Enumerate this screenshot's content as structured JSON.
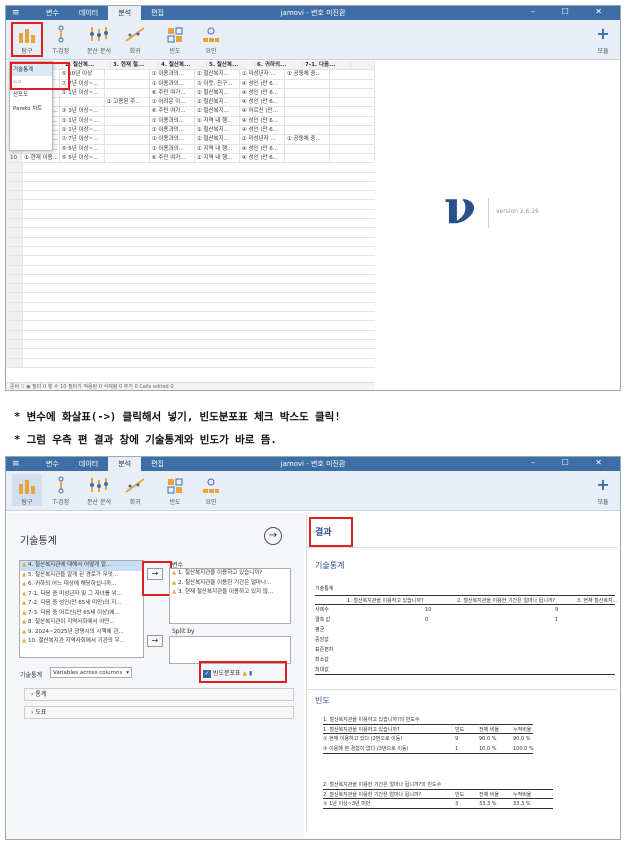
{
  "app": {
    "title": "jamovi - 변호 미진환",
    "menu_icon": "≡",
    "tabs": [
      "변수",
      "데이터",
      "분석",
      "편집"
    ],
    "active_tab": "분석",
    "window_controls": "–  ☐  ✕"
  },
  "ribbon": {
    "buttons": [
      {
        "label": "탐구",
        "icon": "bar-chart-icon"
      },
      {
        "label": "T-검정",
        "icon": "ttest-icon"
      },
      {
        "label": "분산 분석",
        "icon": "anova-icon"
      },
      {
        "label": "회귀",
        "icon": "regression-icon"
      },
      {
        "label": "빈도",
        "icon": "frequency-icon"
      },
      {
        "label": "요인",
        "icon": "factor-icon"
      }
    ],
    "modules_label": "모듈"
  },
  "explore_menu": {
    "items": [
      "기술통계",
      "산포도",
      "Pareto 차트"
    ],
    "extra": "scat"
  },
  "spreadsheet": {
    "headers": [
      "2. 철산복...",
      "3. 현재 철...",
      "4. 철산복...",
      "5. 철산복...",
      "6. 귀하의...",
      "7-1. 다음...",
      ""
    ],
    "header_first": [
      "1"
    ],
    "rows": [
      [
        "1",
        "",
        "⑤ 10년 이상",
        "",
        "① 이용과의...",
        "② 철산복지...",
        "① 미성년자 ...",
        "① 공동체 중...",
        ""
      ],
      [
        "2",
        "",
        "⑦ 7년 이상~...",
        "",
        "① 이용과의...",
        "③ 이웃, 친구...",
        "④ 성인 (만 6...",
        "",
        ""
      ],
      [
        "3",
        "",
        "① 1년 이상~...",
        "",
        "⑥ 주민 여가...",
        "② 철산복지...",
        "④ 성인 (만 6...",
        "",
        ""
      ],
      [
        "4",
        "",
        "",
        "① 고용된 주...",
        "① 어려운 이...",
        "① 철산복지...",
        "④ 성인 (만 6...",
        "",
        ""
      ],
      [
        "5",
        "① 현재 이용...",
        "③ 3년 이상~...",
        "",
        "⑥ 주민 여가...",
        "② 철산복지...",
        "④ 어르신 (만...",
        "",
        ""
      ],
      [
        "6",
        "① 현재 이용...",
        "① 1년 이상~...",
        "",
        "① 이용과의...",
        "① 지역 내 행...",
        "④ 성인 (만 6...",
        "",
        ""
      ],
      [
        "7",
        "① 현재 이용...",
        "① 1년 이상~...",
        "",
        "① 이용과의...",
        "② 철산복지...",
        "④ 성인 (만 6...",
        "",
        ""
      ],
      [
        "8",
        "① 현재 이용...",
        "⑦ 7년 이상~...",
        "",
        "① 이용과의...",
        "② 철산복지...",
        "① 미성년자 ...",
        "① 공동체 중...",
        ""
      ],
      [
        "9",
        "① 현재 이용...",
        "⑤ 5년 이상~...",
        "",
        "① 이용과의...",
        "① 지역 내 행...",
        "④ 성인 (만 6...",
        "",
        ""
      ],
      [
        "10",
        "① 현재 이용...",
        "⑤ 5년 이상~...",
        "",
        "⑥ 주민 여가...",
        "① 지역 내 행...",
        "④ 성인 (만 6...",
        "",
        ""
      ]
    ],
    "status": "준비     ▽  ◉  필터 0                                  행 수 10    필터가 적용된 0    삭제됨 0    추가 0    Cells edited 0"
  },
  "splash": {
    "version": "version 2.6.26"
  },
  "captions": [
    "* 변수에 화살표(->) 클릭해서 넣기, 빈도분포표 체크 박스도 클릭!",
    "* 그럼 우측 편 결과 창에 기술통계와 빈도가 바로 뜸."
  ],
  "analysis": {
    "title": "기술통계",
    "source_vars": [
      "4. 철산복지관에 대해서 어떻게 알...",
      "5. 철산복지관을 알게 된 경로가 무엇...",
      "6. 귀하의 어느 대상에 해당하십니까...",
      "7-1. 다음 중 미성년자 및 그 자녀를 위...",
      "7-2. 다음 중 성인(만 65세 미만)의 지...",
      "7-3. 다음 중 어르신(만 65세 이상)에...",
      "8. 철산복지관이 지역사회에서 어떤...",
      "9. 2024~2025년 광명시의 시책에 관...",
      "10. 철산복지관 지역사회에서 기관의 우..."
    ],
    "variables_label": "변수",
    "target_vars": [
      "1. 철산복지관을 이용하고 있습니까?",
      "2. 철산복지관을 이용한 기간은 얼마나...",
      "3. 현재 철산복지관을 이용하고 있지 않..."
    ],
    "splitby_label": "Split by",
    "desc_label": "기술통계",
    "desc_select": "Variables across columns",
    "freq_label": "빈도분포표",
    "section_stats": "통계",
    "section_plots": "도표",
    "arrow": "→",
    "back_icon": "→"
  },
  "results": {
    "header": "결과",
    "desc_title": "기술통계",
    "desc_subtitle": "기술통계",
    "desc_cols": [
      "1. 철산복지관을 이용하고 있습니까?",
      "2. 철산복지관을 이용한 기간은 얼마나 됩니까?",
      "3. 현재 철산복지..."
    ],
    "desc_rows": [
      {
        "label": "사례수",
        "v1": "10",
        "v2": "9"
      },
      {
        "label": "결측 값",
        "v1": "0",
        "v2": "1"
      },
      {
        "label": "평균",
        "v1": "",
        "v2": ""
      },
      {
        "label": "중앙값",
        "v1": "",
        "v2": ""
      },
      {
        "label": "표준편차",
        "v1": "",
        "v2": ""
      },
      {
        "label": "최소값",
        "v1": "",
        "v2": ""
      },
      {
        "label": "최대값",
        "v1": "",
        "v2": ""
      }
    ],
    "freq_title": "빈도",
    "freq1_caption": "1. 철산복지관을 이용하고 있습니까?의 빈도수",
    "freq1_cols": [
      "1. 철산복지관을 이용하고 있습니까?",
      "빈도",
      "전체 비율",
      "누적비율"
    ],
    "freq1_rows": [
      [
        "① 현재 이용하고 있다 (2번으로 이동)",
        "9",
        "90.0 %",
        "90.0 %"
      ],
      [
        "③ 이용해 본 경험이 없다 (3번으로 이동)",
        "1",
        "10.0 %",
        "100.0 %"
      ]
    ],
    "freq2_caption": "2. 철산복지관을 이용한 기간은 얼마나 됩니까?의 빈도수",
    "freq2_cols": [
      "2. 철산복지관을 이용한 기간은 얼마나 됩니까?",
      "빈도",
      "전체 비율",
      "누적비율"
    ],
    "freq2_rows": [
      [
        "① 1년 이상~3년 미만",
        "3",
        "33.3 %",
        "33.3 %"
      ]
    ]
  }
}
